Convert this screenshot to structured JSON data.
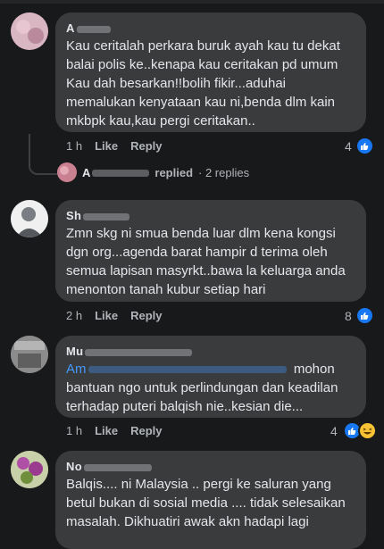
{
  "comments": [
    {
      "author": "A",
      "author_suffix": "...",
      "text": "Kau ceritalah perkara buruk ayah kau tu dekat balai polis ke..kenapa kau ceritakan pd umum Kau dah besarkan!!bolih fikir...aduhai memalukan kenyataan kau ni,benda dlm kain mkbpk kau,kau pergi ceritakan..",
      "time": "1 h",
      "like": "Like",
      "reply": "Reply",
      "reaction_count": "4"
    },
    {
      "author": "Sh",
      "author_suffix": "",
      "text": "Zmn skg ni smua benda luar dlm kena kongsi dgn org...agenda barat hampir d terima oleh semua lapisan masyrkt..bawa la keluarga anda menonton tanah kubur setiap hari",
      "time": "2 h",
      "like": "Like",
      "reply": "Reply",
      "reaction_count": "8"
    },
    {
      "author": "Mu",
      "author_suffix": "",
      "mention": "Am",
      "text": "mohon bantuan ngo untuk perlindungan dan keadilan terhadap puteri balqish nie..kesian die...",
      "time": "1 h",
      "like": "Like",
      "reply": "Reply",
      "reaction_count": "4"
    },
    {
      "author": "No",
      "author_suffix": "",
      "text": "Balqis.... ni Malaysia .. pergi ke saluran yang betul bukan di sosial media .... tidak selesaikan masalah.  Dikhuatiri awak akn hadapi lagi"
    }
  ],
  "reply_thread": {
    "name": "A",
    "verb": "replied",
    "count": "· 2 replies"
  },
  "colors": {
    "background": "#18191a",
    "bubble": "#3a3b3c",
    "like_blue": "#1877f2",
    "mention": "#4599ff"
  }
}
